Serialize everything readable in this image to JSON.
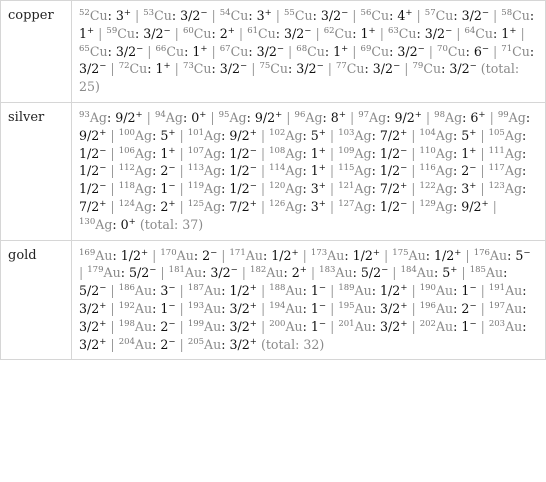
{
  "rows": [
    {
      "element": "copper",
      "symbol": "Cu",
      "total": "(total: 25)",
      "isotopes": [
        {
          "mass": "52",
          "spin": "3",
          "parity": "+"
        },
        {
          "mass": "53",
          "spin": "3/2",
          "parity": "−"
        },
        {
          "mass": "54",
          "spin": "3",
          "parity": "+"
        },
        {
          "mass": "55",
          "spin": "3/2",
          "parity": "−"
        },
        {
          "mass": "56",
          "spin": "4",
          "parity": "+"
        },
        {
          "mass": "57",
          "spin": "3/2",
          "parity": "−"
        },
        {
          "mass": "58",
          "spin": "1",
          "parity": "+"
        },
        {
          "mass": "59",
          "spin": "3/2",
          "parity": "−"
        },
        {
          "mass": "60",
          "spin": "2",
          "parity": "+"
        },
        {
          "mass": "61",
          "spin": "3/2",
          "parity": "−"
        },
        {
          "mass": "62",
          "spin": "1",
          "parity": "+"
        },
        {
          "mass": "63",
          "spin": "3/2",
          "parity": "−"
        },
        {
          "mass": "64",
          "spin": "1",
          "parity": "+"
        },
        {
          "mass": "65",
          "spin": "3/2",
          "parity": "−"
        },
        {
          "mass": "66",
          "spin": "1",
          "parity": "+"
        },
        {
          "mass": "67",
          "spin": "3/2",
          "parity": "−"
        },
        {
          "mass": "68",
          "spin": "1",
          "parity": "+"
        },
        {
          "mass": "69",
          "spin": "3/2",
          "parity": "−"
        },
        {
          "mass": "70",
          "spin": "6",
          "parity": "−"
        },
        {
          "mass": "71",
          "spin": "3/2",
          "parity": "−"
        },
        {
          "mass": "72",
          "spin": "1",
          "parity": "+"
        },
        {
          "mass": "73",
          "spin": "3/2",
          "parity": "−"
        },
        {
          "mass": "75",
          "spin": "3/2",
          "parity": "−"
        },
        {
          "mass": "77",
          "spin": "3/2",
          "parity": "−"
        },
        {
          "mass": "79",
          "spin": "3/2",
          "parity": "−"
        }
      ]
    },
    {
      "element": "silver",
      "symbol": "Ag",
      "total": "(total: 37)",
      "isotopes": [
        {
          "mass": "93",
          "spin": "9/2",
          "parity": "+"
        },
        {
          "mass": "94",
          "spin": "0",
          "parity": "+"
        },
        {
          "mass": "95",
          "spin": "9/2",
          "parity": "+"
        },
        {
          "mass": "96",
          "spin": "8",
          "parity": "+"
        },
        {
          "mass": "97",
          "spin": "9/2",
          "parity": "+"
        },
        {
          "mass": "98",
          "spin": "6",
          "parity": "+"
        },
        {
          "mass": "99",
          "spin": "9/2",
          "parity": "+"
        },
        {
          "mass": "100",
          "spin": "5",
          "parity": "+"
        },
        {
          "mass": "101",
          "spin": "9/2",
          "parity": "+"
        },
        {
          "mass": "102",
          "spin": "5",
          "parity": "+"
        },
        {
          "mass": "103",
          "spin": "7/2",
          "parity": "+"
        },
        {
          "mass": "104",
          "spin": "5",
          "parity": "+"
        },
        {
          "mass": "105",
          "spin": "1/2",
          "parity": "−"
        },
        {
          "mass": "106",
          "spin": "1",
          "parity": "+"
        },
        {
          "mass": "107",
          "spin": "1/2",
          "parity": "−"
        },
        {
          "mass": "108",
          "spin": "1",
          "parity": "+"
        },
        {
          "mass": "109",
          "spin": "1/2",
          "parity": "−"
        },
        {
          "mass": "110",
          "spin": "1",
          "parity": "+"
        },
        {
          "mass": "111",
          "spin": "1/2",
          "parity": "−"
        },
        {
          "mass": "112",
          "spin": "2",
          "parity": "−"
        },
        {
          "mass": "113",
          "spin": "1/2",
          "parity": "−"
        },
        {
          "mass": "114",
          "spin": "1",
          "parity": "+"
        },
        {
          "mass": "115",
          "spin": "1/2",
          "parity": "−"
        },
        {
          "mass": "116",
          "spin": "2",
          "parity": "−"
        },
        {
          "mass": "117",
          "spin": "1/2",
          "parity": "−"
        },
        {
          "mass": "118",
          "spin": "1",
          "parity": "−"
        },
        {
          "mass": "119",
          "spin": "1/2",
          "parity": "−"
        },
        {
          "mass": "120",
          "spin": "3",
          "parity": "+"
        },
        {
          "mass": "121",
          "spin": "7/2",
          "parity": "+"
        },
        {
          "mass": "122",
          "spin": "3",
          "parity": "+"
        },
        {
          "mass": "123",
          "spin": "7/2",
          "parity": "+"
        },
        {
          "mass": "124",
          "spin": "2",
          "parity": "+"
        },
        {
          "mass": "125",
          "spin": "7/2",
          "parity": "+"
        },
        {
          "mass": "126",
          "spin": "3",
          "parity": "+"
        },
        {
          "mass": "127",
          "spin": "1/2",
          "parity": "−"
        },
        {
          "mass": "129",
          "spin": "9/2",
          "parity": "+"
        },
        {
          "mass": "130",
          "spin": "0",
          "parity": "+"
        }
      ]
    },
    {
      "element": "gold",
      "symbol": "Au",
      "total": "(total: 32)",
      "isotopes": [
        {
          "mass": "169",
          "spin": "1/2",
          "parity": "+"
        },
        {
          "mass": "170",
          "spin": "2",
          "parity": "−"
        },
        {
          "mass": "171",
          "spin": "1/2",
          "parity": "+"
        },
        {
          "mass": "173",
          "spin": "1/2",
          "parity": "+"
        },
        {
          "mass": "175",
          "spin": "1/2",
          "parity": "+"
        },
        {
          "mass": "176",
          "spin": "5",
          "parity": "−"
        },
        {
          "mass": "179",
          "spin": "5/2",
          "parity": "−"
        },
        {
          "mass": "181",
          "spin": "3/2",
          "parity": "−"
        },
        {
          "mass": "182",
          "spin": "2",
          "parity": "+"
        },
        {
          "mass": "183",
          "spin": "5/2",
          "parity": "−"
        },
        {
          "mass": "184",
          "spin": "5",
          "parity": "+"
        },
        {
          "mass": "185",
          "spin": "5/2",
          "parity": "−"
        },
        {
          "mass": "186",
          "spin": "3",
          "parity": "−"
        },
        {
          "mass": "187",
          "spin": "1/2",
          "parity": "+"
        },
        {
          "mass": "188",
          "spin": "1",
          "parity": "−"
        },
        {
          "mass": "189",
          "spin": "1/2",
          "parity": "+"
        },
        {
          "mass": "190",
          "spin": "1",
          "parity": "−"
        },
        {
          "mass": "191",
          "spin": "3/2",
          "parity": "+"
        },
        {
          "mass": "192",
          "spin": "1",
          "parity": "−"
        },
        {
          "mass": "193",
          "spin": "3/2",
          "parity": "+"
        },
        {
          "mass": "194",
          "spin": "1",
          "parity": "−"
        },
        {
          "mass": "195",
          "spin": "3/2",
          "parity": "+"
        },
        {
          "mass": "196",
          "spin": "2",
          "parity": "−"
        },
        {
          "mass": "197",
          "spin": "3/2",
          "parity": "+"
        },
        {
          "mass": "198",
          "spin": "2",
          "parity": "−"
        },
        {
          "mass": "199",
          "spin": "3/2",
          "parity": "+"
        },
        {
          "mass": "200",
          "spin": "1",
          "parity": "−"
        },
        {
          "mass": "201",
          "spin": "3/2",
          "parity": "+"
        },
        {
          "mass": "202",
          "spin": "1",
          "parity": "−"
        },
        {
          "mass": "203",
          "spin": "3/2",
          "parity": "+"
        },
        {
          "mass": "204",
          "spin": "2",
          "parity": "−"
        },
        {
          "mass": "205",
          "spin": "3/2",
          "parity": "+"
        }
      ]
    }
  ]
}
